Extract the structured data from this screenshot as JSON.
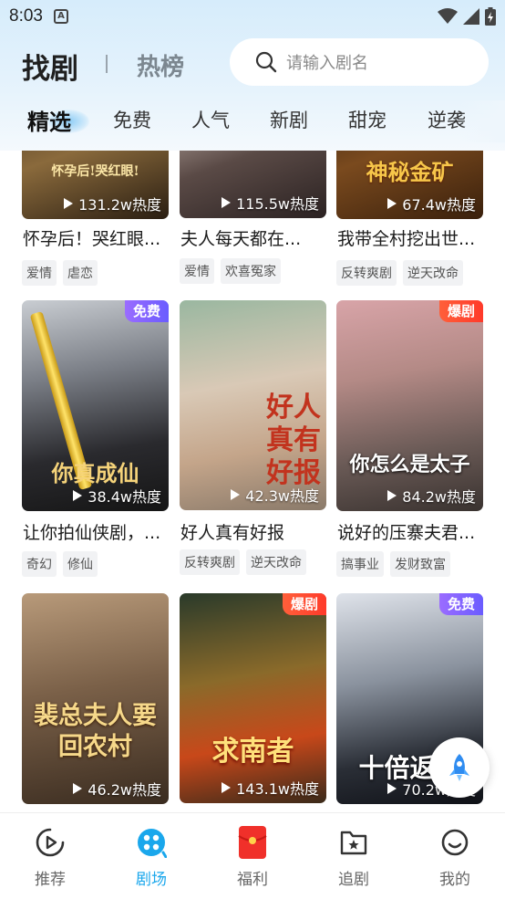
{
  "status": {
    "time": "8:03",
    "a_icon": "A"
  },
  "header": {
    "title": "找剧",
    "subtitle": "热榜",
    "search_placeholder": "请输入剧名"
  },
  "tabs": [
    "精选",
    "免费",
    "人气",
    "新剧",
    "甜宠",
    "逆袭"
  ],
  "cards": [
    {
      "title": "怀孕后！哭红眼...",
      "poster_text": "怀孕后!哭红眼!",
      "heat": "131.2w热度",
      "badge": "",
      "tags": [
        "爱情",
        "虐恋"
      ]
    },
    {
      "title": "夫人每天都在...",
      "poster_text": "",
      "heat": "115.5w热度",
      "badge": "",
      "tags": [
        "爱情",
        "欢喜冤家"
      ]
    },
    {
      "title": "我带全村挖出世...",
      "poster_text": "神秘金矿",
      "heat": "67.4w热度",
      "badge": "",
      "tags": [
        "反转爽剧",
        "逆天改命"
      ]
    },
    {
      "title": "让你拍仙侠剧，...",
      "poster_text": "你真成仙",
      "heat": "38.4w热度",
      "badge": "免费",
      "tags": [
        "奇幻",
        "修仙"
      ]
    },
    {
      "title": "好人真有好报",
      "poster_text": "好人真有好报",
      "heat": "42.3w热度",
      "badge": "",
      "tags": [
        "反转爽剧",
        "逆天改命"
      ]
    },
    {
      "title": "说好的压寨夫君...",
      "poster_text": "你怎么是太子",
      "heat": "84.2w热度",
      "badge": "爆剧",
      "tags": [
        "搞事业",
        "发财致富"
      ]
    },
    {
      "title": "",
      "poster_text": "裴总夫人要回农村",
      "heat": "46.2w热度",
      "badge": "",
      "tags": []
    },
    {
      "title": "",
      "poster_text": "求南者",
      "heat": "143.1w热度",
      "badge": "爆剧",
      "tags": []
    },
    {
      "title": "",
      "poster_text": "十倍返还",
      "heat": "70.2w热度",
      "badge": "免费",
      "tags": []
    }
  ],
  "bottom_nav": [
    {
      "label": "推荐",
      "icon": "play-circle-icon"
    },
    {
      "label": "剧场",
      "icon": "theater-icon"
    },
    {
      "label": "福利",
      "icon": "red-envelope-icon"
    },
    {
      "label": "追剧",
      "icon": "bookmark-star-icon"
    },
    {
      "label": "我的",
      "icon": "smile-icon"
    }
  ],
  "colors": {
    "accent": "#1aa7ec",
    "badge_free": "#7a63ff",
    "badge_hot": "#ff4a30"
  }
}
